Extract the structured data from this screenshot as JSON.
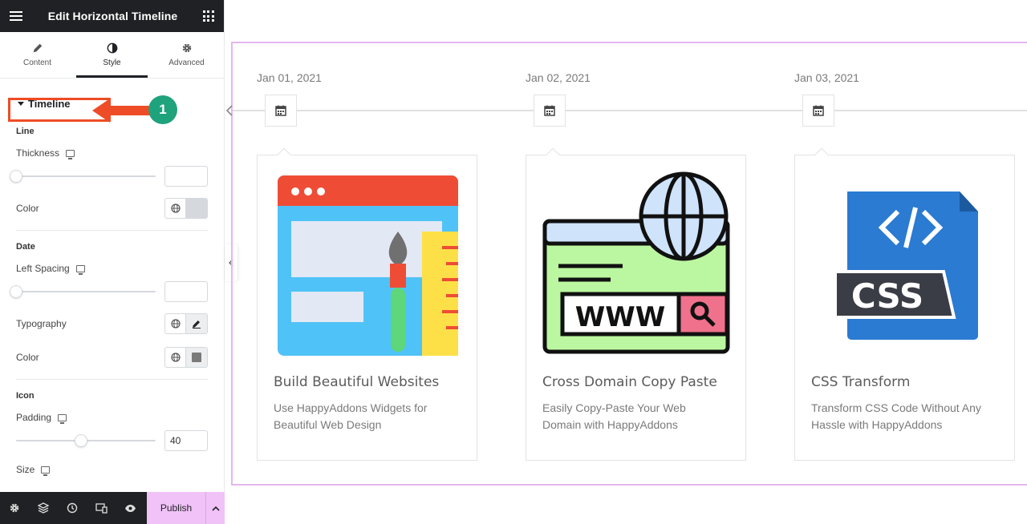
{
  "editor": {
    "title": "Edit Horizontal Timeline",
    "tabs": [
      {
        "label": "Content",
        "icon": "pencil-icon"
      },
      {
        "label": "Style",
        "icon": "contrast-icon"
      },
      {
        "label": "Advanced",
        "icon": "gear-icon"
      }
    ],
    "active_tab": "Style",
    "section_title": "Timeline",
    "line": {
      "group": "Line",
      "thickness_label": "Thickness",
      "thickness_value": "",
      "color_label": "Color"
    },
    "date": {
      "group": "Date",
      "left_spacing_label": "Left Spacing",
      "left_spacing_value": "",
      "typography_label": "Typography",
      "color_label": "Color"
    },
    "icon": {
      "group": "Icon",
      "padding_label": "Padding",
      "padding_value": "40",
      "size_label": "Size"
    },
    "publish_label": "Publish",
    "colors": {
      "accent": "#f0c2f7",
      "dark": "#1f2124",
      "highlight": "#ee4c26",
      "badge": "#1fa37c"
    }
  },
  "annotation": {
    "badge_number": "1"
  },
  "timeline": {
    "items": [
      {
        "date": "Jan 01, 2021",
        "title": "Build Beautiful Websites",
        "description": "Use HappyAddons Widgets for Beautiful Web Design",
        "image": "web-design-illustration"
      },
      {
        "date": "Jan 02, 2021",
        "title": "Cross Domain Copy Paste",
        "description": "Easily Copy-Paste Your Web Domain with HappyAddons",
        "image": "www-globe-illustration"
      },
      {
        "date": "Jan 03, 2021",
        "title": "CSS Transform",
        "description": "Transform CSS Code Without Any Hassle with HappyAddons",
        "image": "css-file-illustration"
      }
    ]
  }
}
